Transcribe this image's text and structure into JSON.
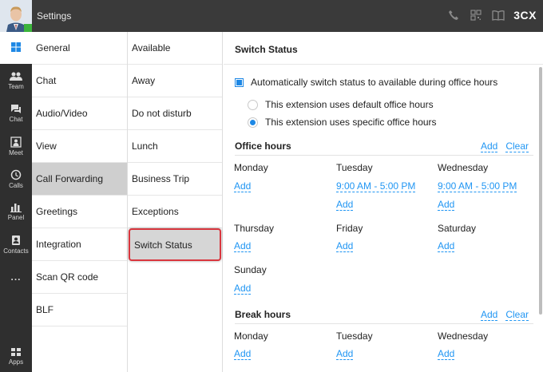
{
  "header": {
    "title": "Settings",
    "brand": "3CX",
    "icons": [
      "phone-icon",
      "qr-code-icon",
      "book-icon"
    ]
  },
  "leftnav": {
    "items": [
      {
        "name": "windows",
        "label": ""
      },
      {
        "name": "team",
        "label": "Team"
      },
      {
        "name": "chat",
        "label": "Chat"
      },
      {
        "name": "meet",
        "label": "Meet"
      },
      {
        "name": "calls",
        "label": "Calls"
      },
      {
        "name": "panel",
        "label": "Panel"
      },
      {
        "name": "contacts",
        "label": "Contacts"
      },
      {
        "name": "more",
        "label": "..."
      },
      {
        "name": "apps",
        "label": "Apps"
      }
    ]
  },
  "settings_menu": {
    "items": [
      "General",
      "Chat",
      "Audio/Video",
      "View",
      "Call Forwarding",
      "Greetings",
      "Integration",
      "Scan QR code",
      "BLF"
    ],
    "selected": "Call Forwarding"
  },
  "status_menu": {
    "items": [
      "Available",
      "Away",
      "Do not disturb",
      "Lunch",
      "Business Trip",
      "Exceptions",
      "Switch Status"
    ],
    "selected": "Switch Status"
  },
  "main": {
    "title": "Switch Status",
    "auto_switch_label": "Automatically switch status to available during office hours",
    "auto_switch_checked": true,
    "radio_default_label": "This extension uses default office hours",
    "radio_specific_label": "This extension uses specific office hours",
    "radio_selected": "specific",
    "office_hours": {
      "title": "Office hours",
      "add_label": "Add",
      "clear_label": "Clear",
      "days": [
        {
          "name": "Monday",
          "slots": [],
          "add": "Add"
        },
        {
          "name": "Tuesday",
          "slots": [
            "9:00 AM - 5:00 PM"
          ],
          "add": "Add"
        },
        {
          "name": "Wednesday",
          "slots": [
            "9:00 AM - 5:00 PM"
          ],
          "add": "Add"
        },
        {
          "name": "Thursday",
          "slots": [],
          "add": "Add"
        },
        {
          "name": "Friday",
          "slots": [],
          "add": "Add"
        },
        {
          "name": "Saturday",
          "slots": [],
          "add": "Add"
        },
        {
          "name": "Sunday",
          "slots": [],
          "add": "Add"
        }
      ]
    },
    "break_hours": {
      "title": "Break hours",
      "add_label": "Add",
      "clear_label": "Clear",
      "days": [
        {
          "name": "Monday",
          "add": "Add"
        },
        {
          "name": "Tuesday",
          "add": "Add"
        },
        {
          "name": "Wednesday",
          "add": "Add"
        }
      ]
    }
  },
  "colors": {
    "accent": "#1e88e5",
    "link": "#2196f3",
    "topbar": "#3a3a3a",
    "sidebar": "#2f2f2f",
    "highlight_border": "#d9363e"
  }
}
